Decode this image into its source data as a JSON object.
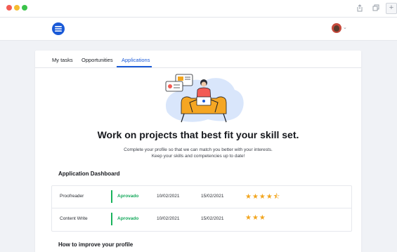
{
  "window": {
    "controls": [
      "close",
      "minimize",
      "maximize"
    ],
    "toolbar_icons": [
      "share-icon",
      "tabs-icon"
    ],
    "new_tab_label": "+"
  },
  "header": {
    "logo_icon": "menu-lines-logo",
    "avatar_caret": "⌄"
  },
  "tabs": [
    {
      "label": "My tasks",
      "active": false
    },
    {
      "label": "Opportunities",
      "active": false
    },
    {
      "label": "Applications",
      "active": true
    }
  ],
  "hero": {
    "title": "Work on projects that best fit your skill set.",
    "subtitle_line1": "Complete your profile so that we can match you better with your interests.",
    "subtitle_line2": "Keep your skills and competencies up to date!"
  },
  "dashboard": {
    "title": "Application Dashboard",
    "rows": [
      {
        "name": "Proofreader",
        "status": "Aprovado",
        "date_start": "10/02/2021",
        "date_end": "15/02/2021",
        "rating": 4.5,
        "stars": "★★★★⯪"
      },
      {
        "name": "Content Write",
        "status": "Aprovado",
        "date_start": "10/02/2021",
        "date_end": "15/02/2021",
        "rating": 3,
        "stars": "★★★"
      }
    ]
  },
  "improve": {
    "title": "How to improve your profile"
  },
  "colors": {
    "accent": "#1a5ad7",
    "status_ok": "#13a85a",
    "star": "#f2a51f",
    "background": "#f0f2f6"
  }
}
